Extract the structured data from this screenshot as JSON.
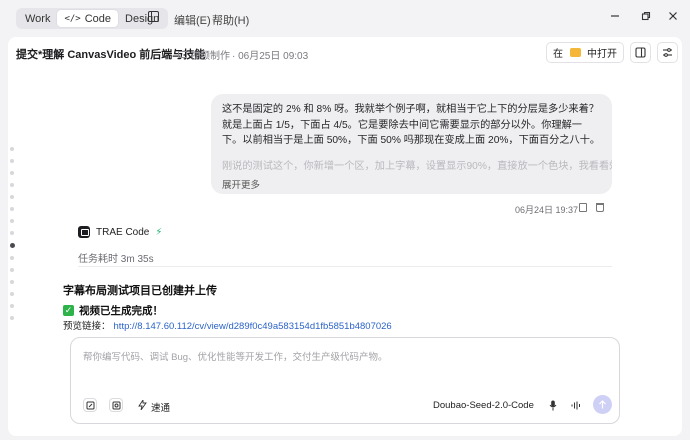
{
  "titlebar": {
    "modes": [
      "Work",
      "</> Code",
      "Design"
    ],
    "mode_work": "Work",
    "mode_code_icon": "</>",
    "mode_code": "Code",
    "mode_design": "Design",
    "menu_edit": "编辑(E)",
    "menu_help": "帮助(H)"
  },
  "header": {
    "title": "提交*理解 CanvasVideo 前后端与技能",
    "folder": "视频制作",
    "date": "· 06月25日 09:03",
    "open_in_prefix": "在",
    "open_in_label": "中打开"
  },
  "user_message": {
    "text": "这不是固定的 2% 和 8% 呀。我就举个例子啊，就相当于它上下的分层是多少来着？就是上面占 1/5，下面占 4/5。它是要除去中间它需要显示的部分以外。你理解一下。以前相当于是上面 50%，下面 50% 吗那现在变成上面 20%，下面百分之八十。",
    "faded_text": "刚说的测试这个，你新增一个区，加上字幕，设置显示90%，直接放一个色块，我看看效果",
    "show_more": "展开更多",
    "timestamp": "06月24日 19:37"
  },
  "assistant": {
    "name": "TRAE Code",
    "duration": "任务耗时 3m 35s",
    "title": "字幕布局测试项目已创建并上传",
    "status": "视频已生成完成！",
    "preview_label": "预览链接：",
    "preview_url": "http://8.147.60.112/cv/view/d289f0c49a583154d1fb5851b4807026"
  },
  "composer": {
    "placeholder": "帮你编写代码、调试 Bug、优化性能等开发工作，交付生产级代码产物。",
    "tool_label": "速通",
    "model": "Doubao-Seed-2.0-Code"
  },
  "colors": {
    "accent_send": "#cfd0f5",
    "link": "#2b63c9",
    "success": "#2db34a"
  }
}
